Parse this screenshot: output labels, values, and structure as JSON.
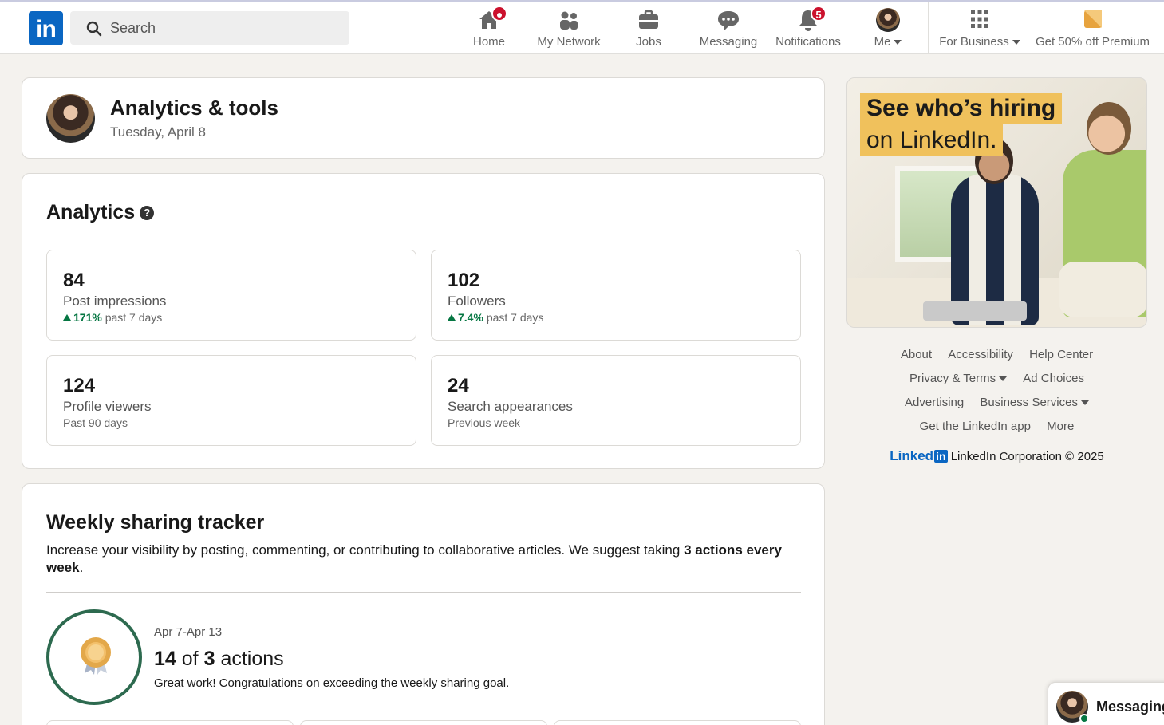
{
  "header": {
    "search_placeholder": "Search",
    "logo_text": "in",
    "nav": [
      {
        "label": "Home",
        "icon": "home-icon",
        "badge": ""
      },
      {
        "label": "My Network",
        "icon": "network-icon",
        "badge": ""
      },
      {
        "label": "Jobs",
        "icon": "briefcase-icon",
        "badge": ""
      },
      {
        "label": "Messaging",
        "icon": "chat-icon",
        "badge": ""
      },
      {
        "label": "Notifications",
        "icon": "bell-icon",
        "badge": "5"
      },
      {
        "label": "Me",
        "icon": "avatar",
        "badge": ""
      },
      {
        "label": "For Business",
        "icon": "grid-icon",
        "badge": ""
      },
      {
        "label": "Get 50% off Premium",
        "icon": "premium-icon",
        "badge": ""
      }
    ]
  },
  "page": {
    "title": "Analytics & tools",
    "date": "Tuesday, April 8"
  },
  "analytics": {
    "heading": "Analytics",
    "stats": [
      {
        "value": "84",
        "label": "Post impressions",
        "change": "171%",
        "period": "past 7 days"
      },
      {
        "value": "102",
        "label": "Followers",
        "change": "7.4%",
        "period": "past 7 days"
      },
      {
        "value": "124",
        "label": "Profile viewers",
        "change": "",
        "period": "Past 90 days"
      },
      {
        "value": "24",
        "label": "Search appearances",
        "change": "",
        "period": "Previous week"
      }
    ]
  },
  "tracker": {
    "heading": "Weekly sharing tracker",
    "desc_pre": "Increase your visibility by posting, commenting, or contributing to collaborative articles. We suggest taking ",
    "desc_bold": "3 actions every week",
    "desc_post": ".",
    "range": "Apr 7-Apr 13",
    "count_done": "14",
    "count_of": "of",
    "count_goal": "3",
    "count_unit": "actions",
    "congrats": "Great work! Congratulations on exceeding the weekly sharing goal."
  },
  "ad": {
    "line1": "See who’s hiring",
    "line2": "on LinkedIn."
  },
  "footer": {
    "links": [
      "About",
      "Accessibility",
      "Help Center",
      "Privacy & Terms",
      "Ad Choices",
      "Advertising",
      "Business Services",
      "Get the LinkedIn app",
      "More"
    ],
    "brand": "Linked",
    "brand_in": "in",
    "corp": "LinkedIn Corporation © 2025"
  },
  "messaging_bar": {
    "label": "Messaging"
  },
  "colors": {
    "brand": "#0a66c2",
    "badge": "#cb112d",
    "positive": "#057642",
    "ring": "#2d6a4f",
    "ad_highlight": "#f0c15c"
  }
}
